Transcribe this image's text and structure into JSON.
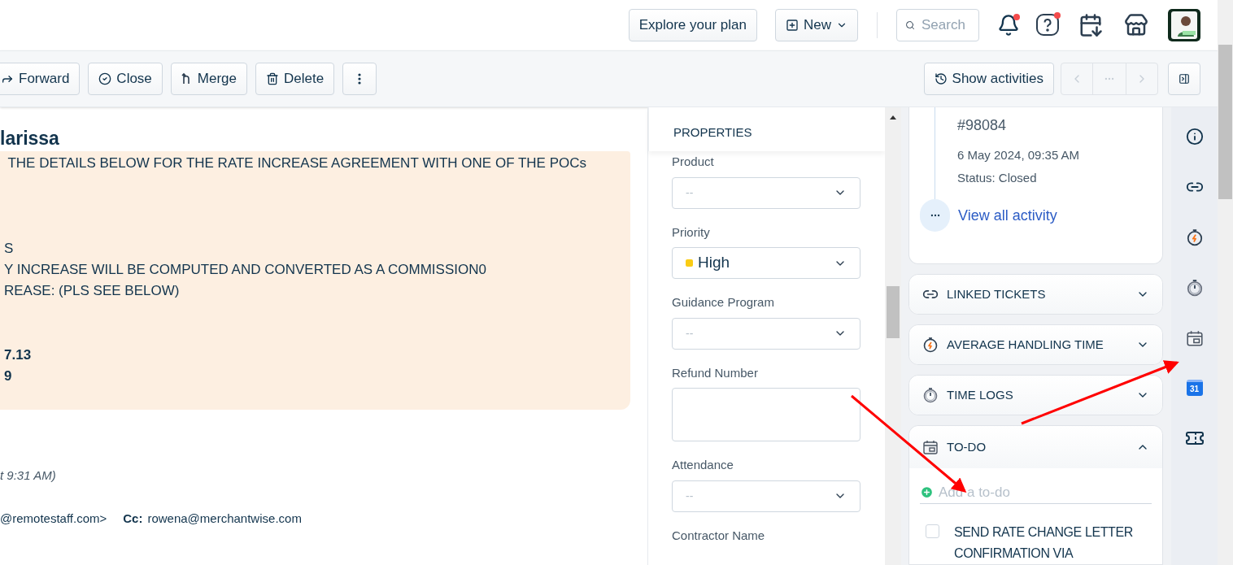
{
  "top_bar": {
    "explore_button": "Explore your plan",
    "new_button": "New",
    "search": {
      "placeholder": "Search"
    },
    "notifications_unread": true,
    "help_unread": true
  },
  "toolbar": {
    "actions": [
      {
        "label": "Forward",
        "kind": "forward"
      },
      {
        "label": "Close",
        "kind": "close"
      },
      {
        "label": "Merge",
        "kind": "merge"
      },
      {
        "label": "Delete",
        "kind": "delete"
      },
      {
        "kind": "more"
      }
    ],
    "show_activities": "Show activities",
    "pager": {
      "prev_disabled": true,
      "next_disabled": true
    }
  },
  "email": {
    "sender": "larissa",
    "paragraphs": [
      {
        "bold": false,
        "lines": [
          " THE DETAILS BELOW FOR THE RATE INCREASE AGREEMENT WITH ONE OF THE POCs"
        ]
      },
      {
        "bold": false,
        "lines": [
          "S",
          "Y INCREASE WILL BE COMPUTED AND CONVERTED AS A COMMISSION0",
          "REASE: (PLS SEE BELOW)"
        ]
      },
      {
        "bold": true,
        "lines": [
          "7.13",
          "9"
        ]
      }
    ],
    "timestamp": "t 9:31 AM)",
    "from": "@remotestaff.com>",
    "cc_label": "Cc:",
    "cc": "rowena@merchantwise.com"
  },
  "properties": {
    "title": "PROPERTIES",
    "fields": [
      {
        "label": "Product",
        "kind": "select",
        "placeholder": "--"
      },
      {
        "label": "Priority",
        "kind": "select",
        "value": "High",
        "color": "#facc15"
      },
      {
        "label": "Guidance Program",
        "kind": "select",
        "placeholder": "--"
      },
      {
        "label": "Refund Number",
        "kind": "textarea"
      },
      {
        "label": "Attendance",
        "kind": "select",
        "placeholder": "--"
      },
      {
        "label": "Contractor Name",
        "kind": "label"
      }
    ]
  },
  "activity": {
    "ticket": "#98084",
    "date": "6 May 2024, 09:35 AM",
    "status": "Status: Closed",
    "view_all": "View all activity"
  },
  "sections": [
    {
      "title": "LINKED TICKETS",
      "kind": "link",
      "expanded": false
    },
    {
      "title": "AVERAGE HANDLING TIME",
      "kind": "aht",
      "expanded": false
    },
    {
      "title": "TIME LOGS",
      "kind": "timer",
      "expanded": false
    },
    {
      "title": "TO-DO",
      "kind": "todo",
      "expanded": true
    }
  ],
  "todo": {
    "placeholder": "Add a to-do",
    "items": [
      {
        "text": "SEND RATE CHANGE LETTER CONFIRMATION VIA",
        "checked": false
      }
    ]
  },
  "rail": {
    "calendar_badge": "31"
  }
}
